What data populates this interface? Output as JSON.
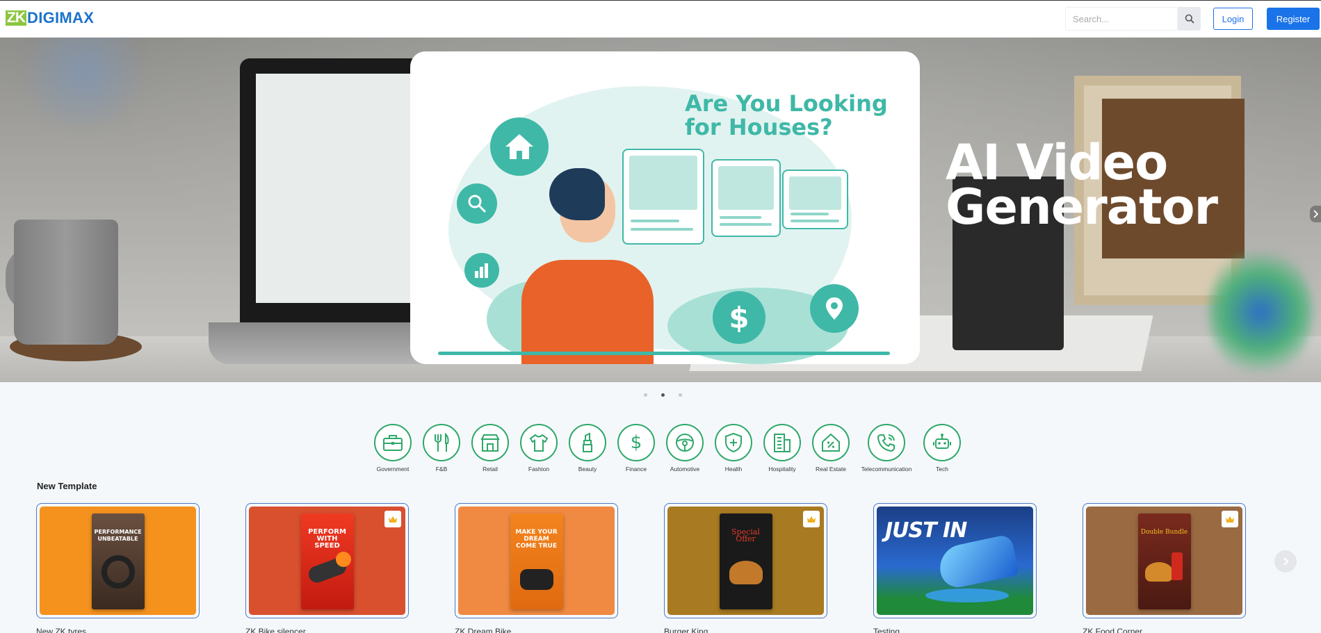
{
  "header": {
    "logo_mark": "ZK",
    "logo_text": "DIGIMAX",
    "search_placeholder": "Search...",
    "login_label": "Login",
    "register_label": "Register",
    "brand_color": "#1a73e8",
    "logo_green": "#8cc63f"
  },
  "hero": {
    "title_line1": "AI Video",
    "title_line2": "Generator",
    "card_heading_line1": "Are You Looking",
    "card_heading_line2": "for Houses?",
    "slides_total": 3,
    "active_slide": 2,
    "accent_color": "#3fb8a7"
  },
  "categories": [
    {
      "label": "Government",
      "icon": "briefcase-icon"
    },
    {
      "label": "F&B",
      "icon": "utensils-icon"
    },
    {
      "label": "Retail",
      "icon": "storefront-icon"
    },
    {
      "label": "Fashion",
      "icon": "tshirt-icon"
    },
    {
      "label": "Beauty",
      "icon": "lipstick-icon"
    },
    {
      "label": "Finance",
      "icon": "dollar-icon"
    },
    {
      "label": "Automotive",
      "icon": "steering-wheel-icon"
    },
    {
      "label": "Health",
      "icon": "shield-plus-icon"
    },
    {
      "label": "Hospitality",
      "icon": "building-icon"
    },
    {
      "label": "Real Estate",
      "icon": "house-percent-icon"
    },
    {
      "label": "Telecommunication",
      "icon": "phone-icon"
    },
    {
      "label": "Tech",
      "icon": "robot-icon"
    }
  ],
  "templates": {
    "section_title": "New Template",
    "items": [
      {
        "name": "New ZK tyres",
        "bg": "#f5921e",
        "premium": false,
        "poster_text": "PERFORMANCE UNBEATABLE",
        "poster_bg": "#5a4030"
      },
      {
        "name": "ZK Bike silencer",
        "bg": "#d9502f",
        "premium": true,
        "poster_text": "PERFORM WITH SPEED",
        "poster_bg": "#e8331f"
      },
      {
        "name": "ZK Dream Bike",
        "bg": "#f08a42",
        "premium": false,
        "poster_text": "MAKE YOUR DREAM COME TRUE",
        "poster_bg": "#f07a20"
      },
      {
        "name": "Burger King",
        "bg": "#a87a22",
        "premium": true,
        "poster_text": "Special Offer",
        "poster_bg": "#1a1a1a"
      },
      {
        "name": "Testing",
        "bg": "#1b4fa8",
        "premium": false,
        "poster_text": "JUST IN",
        "poster_bg": ""
      },
      {
        "name": "ZK Food Corner",
        "bg": "#9a6a42",
        "premium": true,
        "poster_text": "Double Bundle",
        "poster_bg": "#6b2a1e"
      }
    ]
  }
}
